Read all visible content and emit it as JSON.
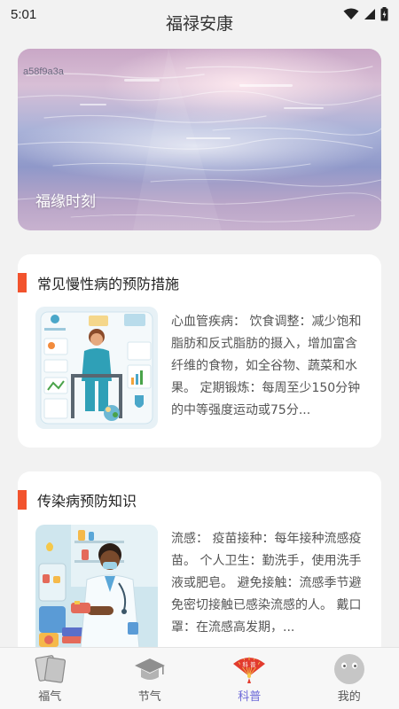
{
  "status_bar": {
    "time": "5:01"
  },
  "app": {
    "title": "福禄安康"
  },
  "banner": {
    "image_id": "a58f9a3a",
    "caption": "福缘时刻"
  },
  "articles": [
    {
      "title": "常见慢性病的预防措施",
      "summary": "心血管疾病： 饮食调整：减少饱和脂肪和反式脂肪的摄入，增加富含纤维的食物，如全谷物、蔬菜和水果。 定期锻炼：每周至少150分钟的中等强度运动或75分..."
    },
    {
      "title": "传染病预防知识",
      "summary": "流感： 疫苗接种：每年接种流感疫苗。 个人卫生：勤洗手，使用洗手液或肥皂。 避免接触：流感季节避免密切接触已感染流感的人。 戴口罩：在流感高发期，..."
    }
  ],
  "nav": {
    "items": [
      {
        "label": "福气",
        "icon": "cards-icon"
      },
      {
        "label": "节气",
        "icon": "graduation-cap-icon"
      },
      {
        "label": "科普",
        "icon": "fan-icon"
      },
      {
        "label": "我的",
        "icon": "avatar-icon"
      }
    ],
    "active_index": 2,
    "active_color": "#6d6ad8",
    "accent_color": "#f2532d"
  }
}
